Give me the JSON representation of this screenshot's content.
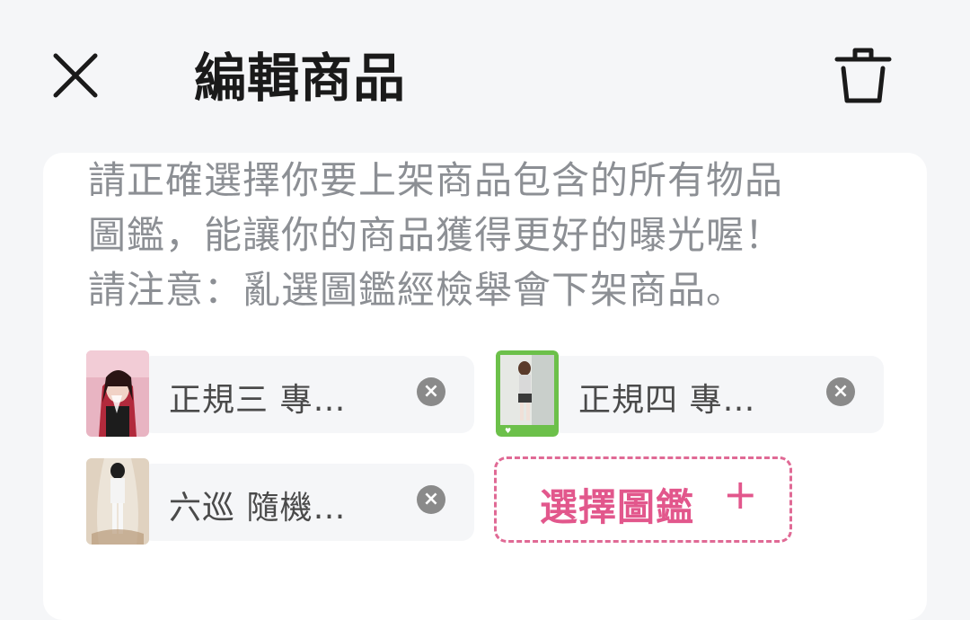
{
  "header": {
    "title": "編輯商品",
    "close_icon": "close-icon",
    "delete_icon": "trash-icon"
  },
  "notice": {
    "lines": [
      "請正確選擇你要上架商品包含的所有物品",
      "圖鑑，能讓你的商品獲得更好的曝光喔！",
      "請注意：亂選圖鑑經檢舉會下架商品。"
    ]
  },
  "selected_items": [
    {
      "label": "正規三 專…",
      "remove": "×"
    },
    {
      "label": "正規四 專…",
      "remove": "×"
    },
    {
      "label": "六巡 隨機…",
      "remove": "×"
    }
  ],
  "add_button": {
    "label": "選擇圖鑑",
    "plus": "+"
  },
  "colors": {
    "accent": "#e2578c",
    "text_primary": "#1a1a1a",
    "text_secondary": "#8c8f94",
    "background": "#f5f6f8"
  }
}
